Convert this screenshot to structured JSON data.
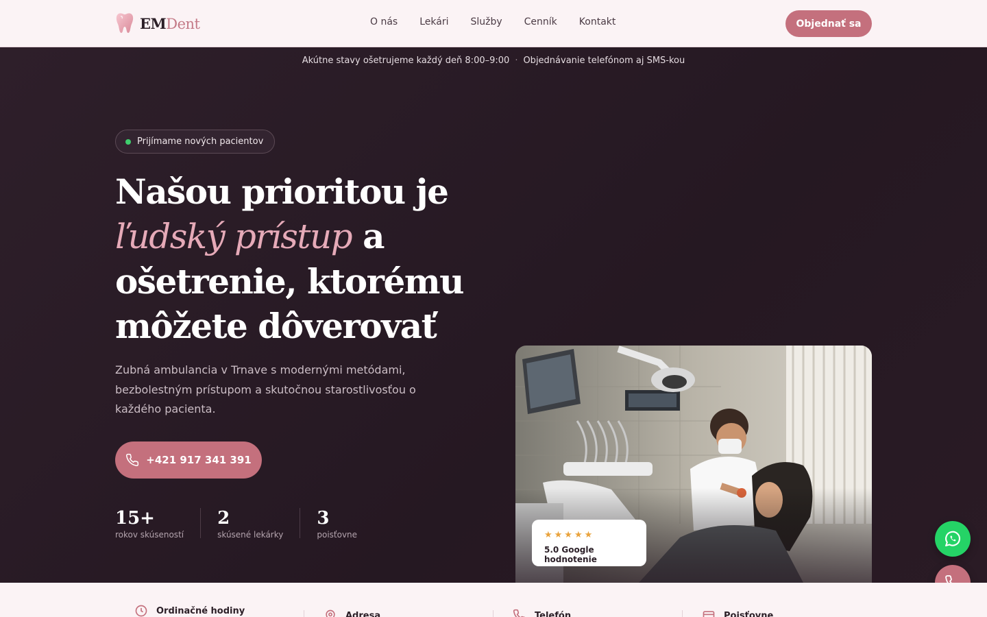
{
  "header": {
    "logo": {
      "part1": "EM",
      "part2": "Dent"
    },
    "nav": [
      "O nás",
      "Lekári",
      "Služby",
      "Cenník",
      "Kontakt"
    ],
    "cta_label": "Objednať sa"
  },
  "hero": {
    "topbar": {
      "left": "Akútne stavy ošetrujeme každý deň 8:00–9:00",
      "separator": "·",
      "right": "Objednávanie telefónom aj SMS-kou"
    },
    "badge": "Prijímame nových pacientov",
    "headline": {
      "line1": "Našou prioritou je",
      "italic": "ľudský prístup",
      "after_italic": "a",
      "line3": "ošetrenie, ktorému",
      "line4": "môžete dôverovať"
    },
    "lead": "Zubná ambulancia v Trnave s modernými metódami, bezbolestným prístupom a skutočnou starostlivosťou o každého pacienta.",
    "phone_label": "+421 917 341 391",
    "stats": [
      {
        "num": "15+",
        "label": "rokov skúseností"
      },
      {
        "num": "2",
        "label": "skúsené lekárky"
      },
      {
        "num": "3",
        "label": "poisťovne"
      }
    ],
    "rating": {
      "stars": "★★★★★",
      "label": "5.0 Google hodnotenie"
    }
  },
  "info": {
    "items": [
      "Ordinačné hodiny",
      "Adresa",
      "Telefón",
      "Poisťovne"
    ]
  },
  "colors": {
    "accent": "#c4707d",
    "hero_bg": "#2a1c26",
    "light_bg": "#fbf3f5",
    "whatsapp": "#25d366"
  },
  "icons": [
    "tooth-logo-icon",
    "phone-icon",
    "whatsapp-icon",
    "clock-icon",
    "pin-icon",
    "card-icon"
  ]
}
